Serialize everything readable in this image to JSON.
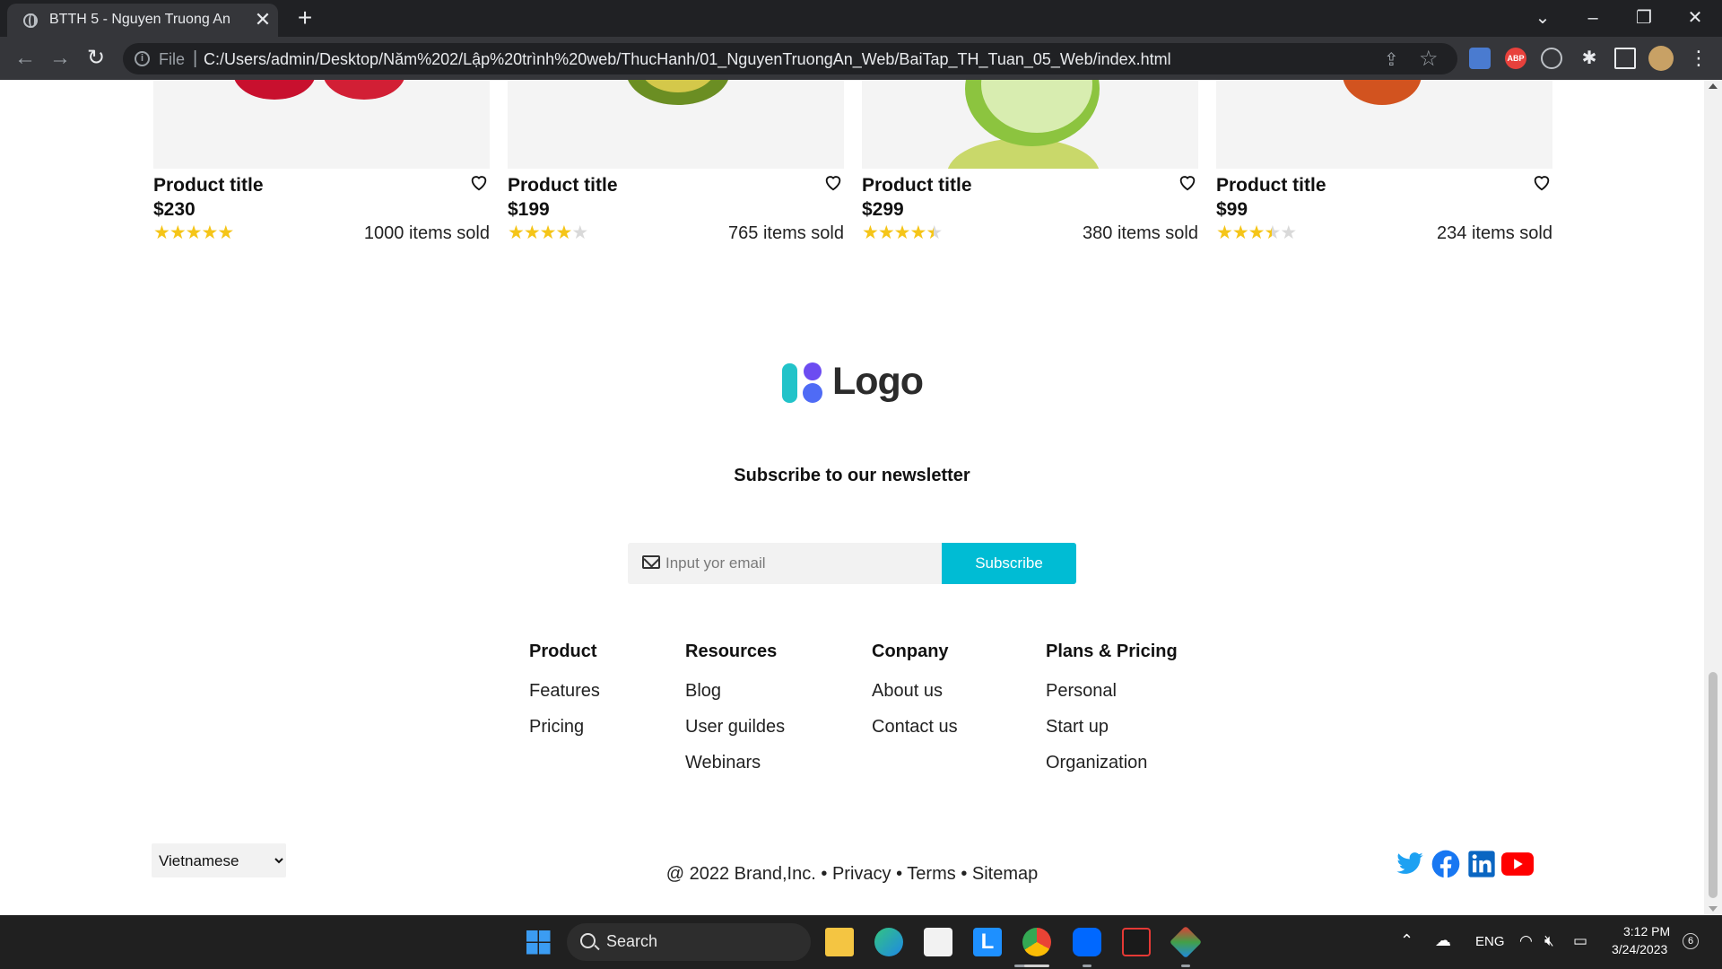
{
  "browser": {
    "tab_title": "BTTH 5 - Nguyen Truong An",
    "scheme_label": "File",
    "url": "C:/Users/admin/Desktop/Năm%202/Lập%20trình%20web/ThucHanh/01_NguyenTruongAn_Web/BaiTap_TH_Tuan_05_Web/index.html",
    "extension_abp": "ABP"
  },
  "products": [
    {
      "title": "Product title",
      "price": "$230",
      "rating": 5,
      "sold": "1000 items sold"
    },
    {
      "title": "Product title",
      "price": "$199",
      "rating": 4,
      "sold": "765 items sold"
    },
    {
      "title": "Product title",
      "price": "$299",
      "rating": 4.5,
      "sold": "380 items sold"
    },
    {
      "title": "Product title",
      "price": "$99",
      "rating": 3.5,
      "sold": "234 items sold"
    }
  ],
  "footer": {
    "logo_text": "Logo",
    "newsletter_title": "Subscribe to our newsletter",
    "email_placeholder": "Input yor email",
    "subscribe_label": "Subscribe",
    "columns": [
      {
        "heading": "Product",
        "links": [
          "Features",
          "Pricing"
        ]
      },
      {
        "heading": "Resources",
        "links": [
          "Blog",
          "User guildes",
          "Webinars"
        ]
      },
      {
        "heading": "Conpany",
        "links": [
          "About us",
          "Contact us"
        ]
      },
      {
        "heading": "Plans & Pricing",
        "links": [
          "Personal",
          "Start up",
          "Organization"
        ]
      }
    ],
    "language": "Vietnamese",
    "copyright": "@ 2022 Brand,Inc.",
    "bullet": "•",
    "privacy": "Privacy",
    "terms": "Terms",
    "sitemap": "Sitemap",
    "social_icons": [
      "twitter-icon",
      "facebook-icon",
      "linkedin-icon",
      "youtube-icon"
    ]
  },
  "taskbar": {
    "search_label": "Search",
    "language": "ENG",
    "time": "3:12 PM",
    "date": "3/24/2023",
    "notification_count": "6"
  },
  "colors": {
    "accent": "#00bcd4",
    "star": "#f5c518",
    "chrome_dark": "#202124"
  }
}
